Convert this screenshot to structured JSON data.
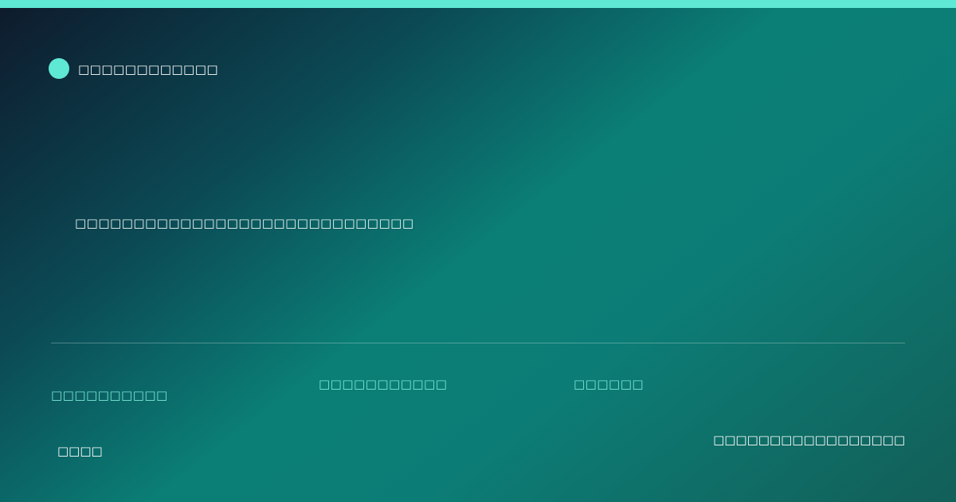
{
  "theme": {
    "accent": "#5fe8d4",
    "meta_text": "#7ae8d6"
  },
  "brand": {
    "name": "□□□□□□□□□□□□",
    "icon": "circle-dot-icon"
  },
  "headline": "□□□□□□□□□□□□□□□□□□□□□□□□□□□□□",
  "meta": [
    "□□□□□□□□□□",
    "□□□□□□□□□□□",
    "□□□□□□"
  ],
  "footer": {
    "left": "□□□□",
    "right": "□□□□□□□□□□□□□□□□□"
  }
}
